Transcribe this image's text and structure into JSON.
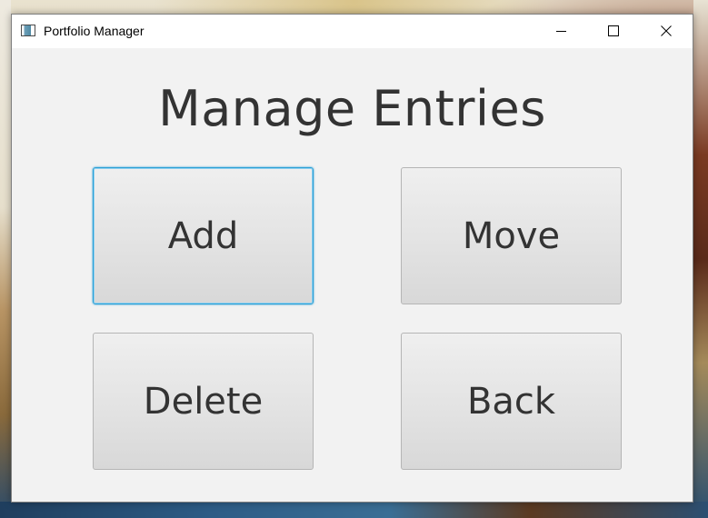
{
  "window": {
    "title": "Portfolio Manager"
  },
  "content": {
    "heading": "Manage Entries",
    "buttons": {
      "add": "Add",
      "move": "Move",
      "delete": "Delete",
      "back": "Back"
    },
    "focused_button": "add"
  },
  "icons": {
    "app": "app-window-icon",
    "minimize": "minimize-icon",
    "maximize": "maximize-icon",
    "close": "close-icon"
  },
  "colors": {
    "window_bg": "#f2f2f2",
    "titlebar_bg": "#ffffff",
    "text": "#333333",
    "focus_ring": "#2a9fd6",
    "button_border": "#b5b5b5"
  }
}
